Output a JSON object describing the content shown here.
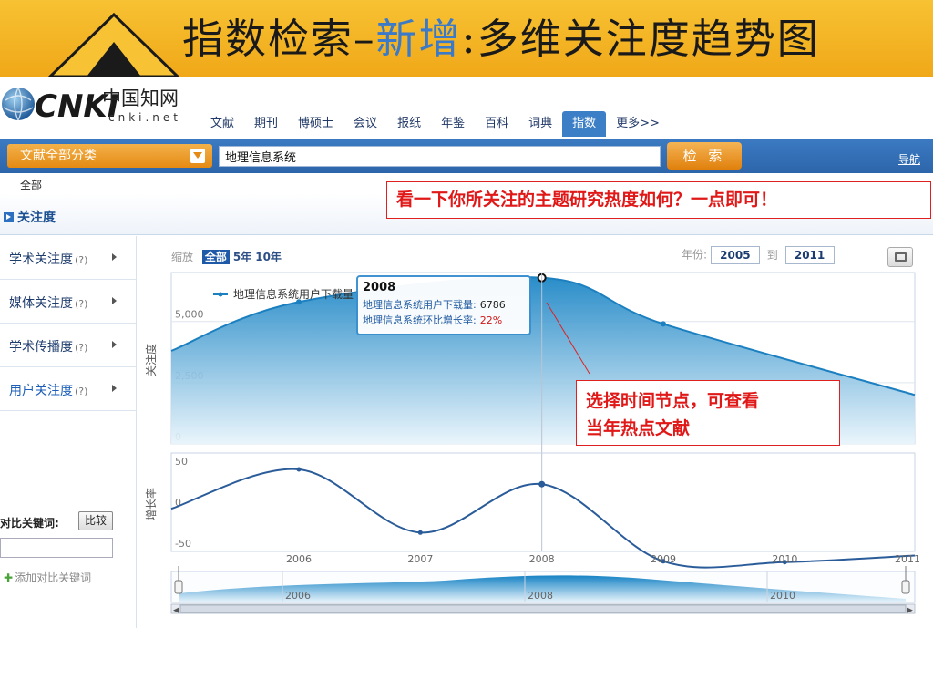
{
  "banner": {
    "title_part1": "指数检索–",
    "title_highlight": "新增",
    "title_part2": ":多维关注度趋势图",
    "accent_color": "#3a7ac8"
  },
  "logo": {
    "brand": "CNKI",
    "cn_name": "中国知网",
    "domain": "cnki.net"
  },
  "nav": {
    "tabs": [
      {
        "label": "文献"
      },
      {
        "label": "期刊"
      },
      {
        "label": "博硕士"
      },
      {
        "label": "会议"
      },
      {
        "label": "报纸"
      },
      {
        "label": "年鉴"
      },
      {
        "label": "百科"
      },
      {
        "label": "词典"
      },
      {
        "label": "指数",
        "active": true
      },
      {
        "label": "更多>>"
      }
    ]
  },
  "search": {
    "category_label": "文献全部分类",
    "query": "地理信息系统",
    "button_label": "检 索",
    "guide_label": "导航"
  },
  "breadcrumb": {
    "all": "全部"
  },
  "section": {
    "title": "关注度"
  },
  "callouts": {
    "top": "看一下你所关注的主题研究热度如何？一点即可！",
    "line1": "选择时间节点，可查看",
    "line2": "当年热点文献"
  },
  "sidebar": {
    "items": [
      {
        "label": "学术关注度",
        "help": "?"
      },
      {
        "label": "媒体关注度",
        "help": "?"
      },
      {
        "label": "学术传播度",
        "help": "?"
      },
      {
        "label": "用户关注度",
        "help": "?",
        "active": true
      }
    ],
    "compare_label": "对比关键词:",
    "compare_button": "比较",
    "add_compare": "添加对比关键词"
  },
  "chart_toolbar": {
    "zoom_label": "缩放",
    "options": [
      "全部",
      "5年",
      "10年"
    ],
    "selected": "全部",
    "year_label": "年份:",
    "year_from": "2005",
    "year_to_label": "到",
    "year_to": "2011"
  },
  "tooltip": {
    "year": "2008",
    "line1_label": "地理信息系统用户下载量:",
    "line1_value": "6786",
    "line2_label": "地理信息系统环比增长率:",
    "line2_value": "22%"
  },
  "chart_data": [
    {
      "type": "area",
      "ylabel": "关注度",
      "ylim": [
        0,
        7000
      ],
      "yticks": [
        0,
        2500,
        5000
      ],
      "ytick_labels": [
        "0",
        "2,500",
        "5,000"
      ],
      "series": [
        {
          "name": "地理信息系统用户下载量",
          "x": [
            2005,
            2006,
            2008,
            2009,
            2011
          ],
          "values": [
            3800,
            5800,
            6786,
            4900,
            2000
          ]
        }
      ],
      "highlight_x": 2008,
      "color": "#1f87c5"
    },
    {
      "type": "line",
      "ylabel": "增长率",
      "ylim": [
        -60,
        60
      ],
      "yticks": [
        -50,
        0,
        50
      ],
      "ytick_labels": [
        "-50",
        "0",
        "50"
      ],
      "x_tick_labels": [
        "2006",
        "2007",
        "2008",
        "2009",
        "2010",
        "2011"
      ],
      "series": [
        {
          "name": "地理信息系统环比增长率",
          "x": [
            2005,
            2006,
            2007,
            2008,
            2009,
            2010,
            2011
          ],
          "values": [
            -8,
            40,
            -37,
            22,
            -72,
            -73,
            -65
          ]
        }
      ],
      "color": "#2a5c9a"
    },
    {
      "type": "area",
      "role": "navigator",
      "x_tick_labels": [
        "2006",
        "2008",
        "2010"
      ]
    }
  ]
}
